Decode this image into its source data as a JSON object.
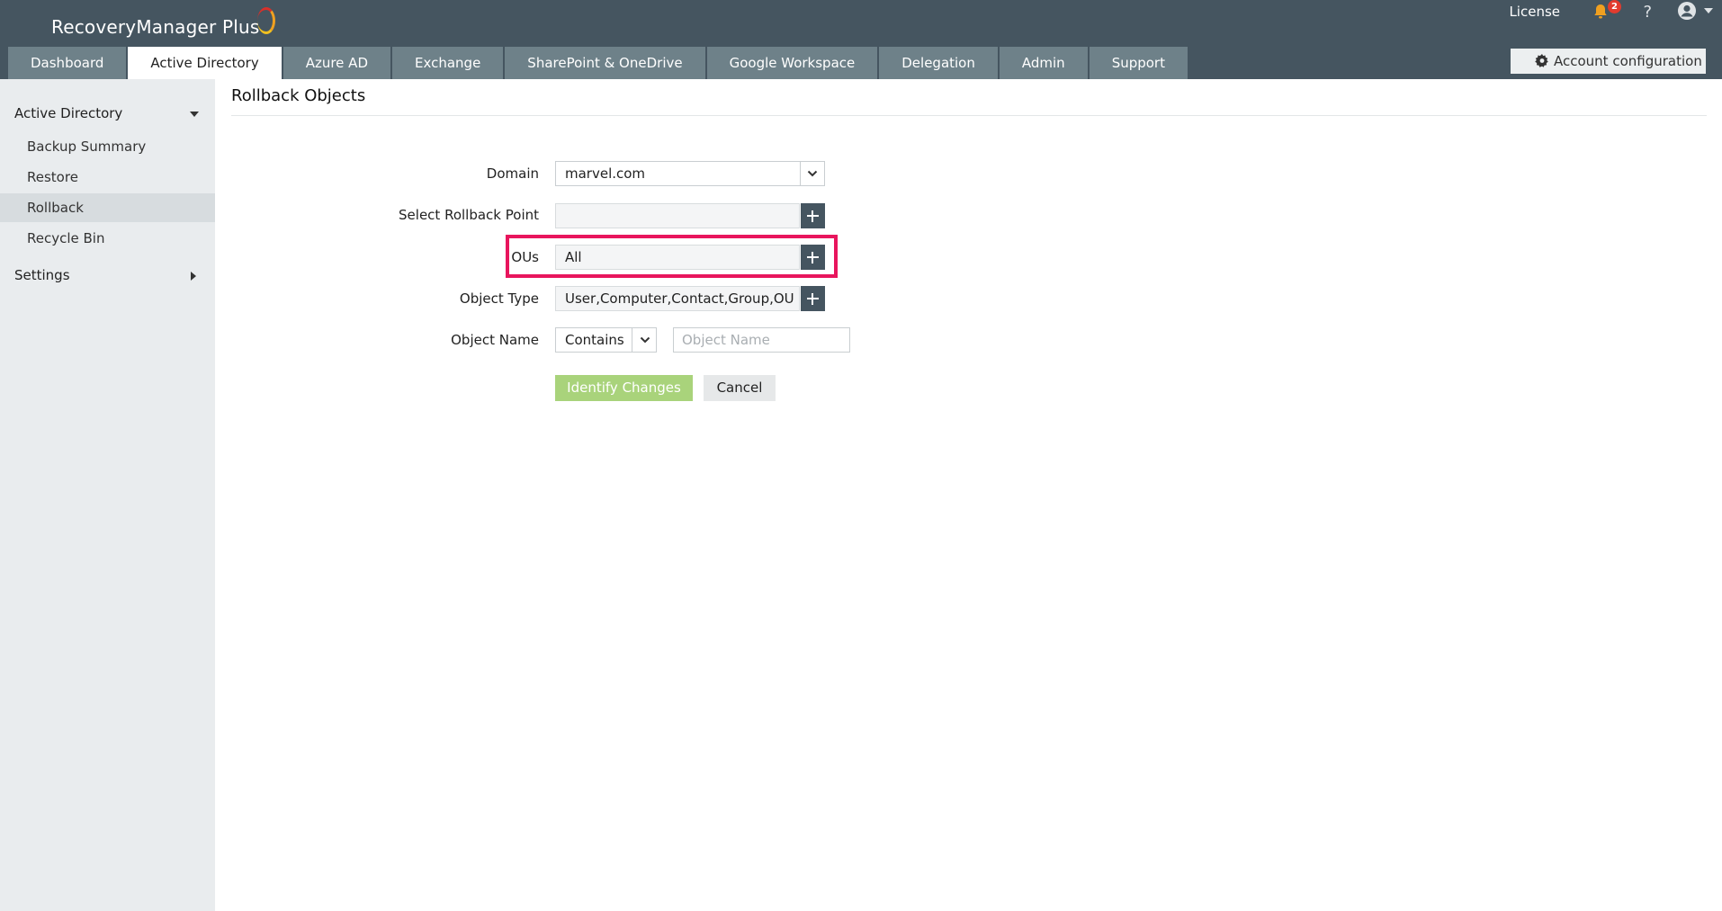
{
  "app": {
    "brand": "RecoveryManager Plus"
  },
  "header": {
    "license_label": "License",
    "notification_count": "2",
    "help_label": "?",
    "account_config_label": "Account configuration"
  },
  "tabs": [
    {
      "label": "Dashboard",
      "active": false
    },
    {
      "label": "Active Directory",
      "active": true
    },
    {
      "label": "Azure AD",
      "active": false
    },
    {
      "label": "Exchange",
      "active": false
    },
    {
      "label": "SharePoint & OneDrive",
      "active": false
    },
    {
      "label": "Google Workspace",
      "active": false
    },
    {
      "label": "Delegation",
      "active": false
    },
    {
      "label": "Admin",
      "active": false
    },
    {
      "label": "Support",
      "active": false
    }
  ],
  "sidebar": {
    "section_active_directory": "Active Directory",
    "items": [
      {
        "label": "Backup Summary",
        "active": false
      },
      {
        "label": "Restore",
        "active": false
      },
      {
        "label": "Rollback",
        "active": true
      },
      {
        "label": "Recycle Bin",
        "active": false
      }
    ],
    "section_settings": "Settings"
  },
  "main": {
    "title": "Rollback Objects",
    "form": {
      "domain_label": "Domain",
      "domain_value": "marvel.com",
      "rollback_point_label": "Select Rollback Point",
      "rollback_point_value": "",
      "ous_label": "OUs",
      "ous_value": "All",
      "object_type_label": "Object Type",
      "object_type_value": "User,Computer,Contact,Group,OU,DN",
      "object_name_label": "Object Name",
      "object_name_operator": "Contains",
      "object_name_placeholder": "Object Name",
      "object_name_value": ""
    },
    "buttons": {
      "identify_changes": "Identify Changes",
      "cancel": "Cancel"
    }
  },
  "colors": {
    "header_bg": "#455560",
    "tab_bg": "#6e8189",
    "primary_button": "#a9d37b",
    "highlight": "#e8155d"
  }
}
